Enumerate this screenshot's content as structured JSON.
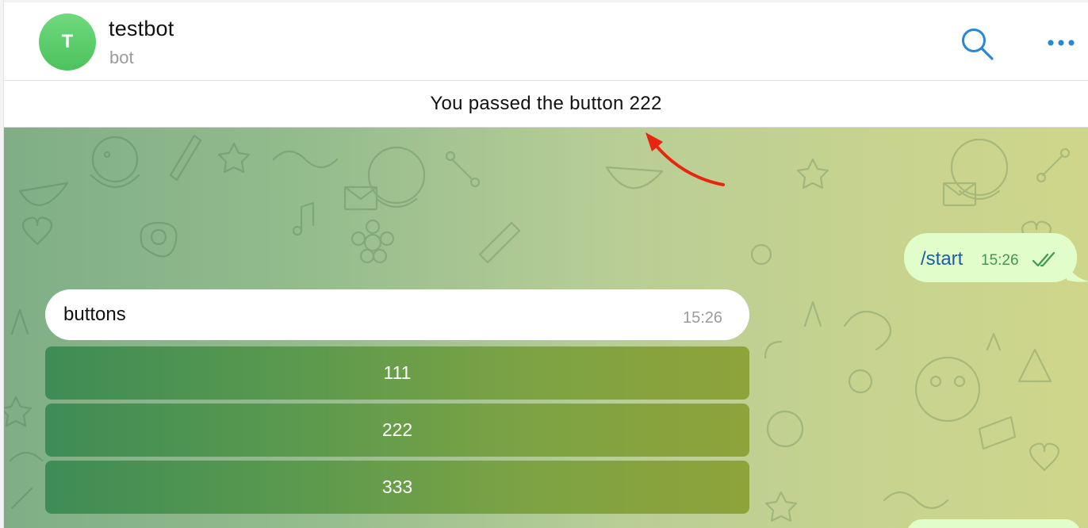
{
  "header": {
    "avatar_letter": "T",
    "title": "testbot",
    "subtitle": "bot",
    "search_icon": "search-icon",
    "more_icon": "more-horizontal-icon"
  },
  "status_bar": {
    "text": "You passed the button 222"
  },
  "messages": {
    "outgoing": {
      "text": "/start",
      "time": "15:26",
      "status_icon": "double-check-icon"
    },
    "incoming": {
      "text": "buttons",
      "time": "15:26"
    }
  },
  "inline_keyboard": {
    "buttons": [
      {
        "label": "111"
      },
      {
        "label": "222"
      },
      {
        "label": "333"
      }
    ]
  },
  "colors": {
    "accent": "#2a86d8",
    "avatar": "#5acb69",
    "outgoing_bubble": "#e1fdc9",
    "annotation_arrow": "#e8260f"
  }
}
